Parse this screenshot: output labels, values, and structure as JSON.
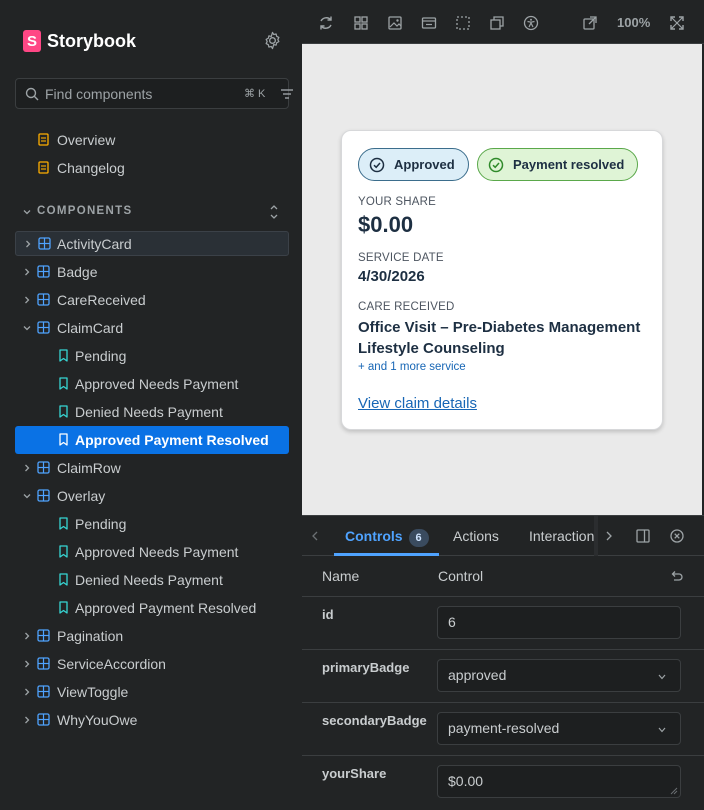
{
  "sidebar": {
    "brand": "Storybook",
    "search_placeholder": "Find components",
    "shortcut": "⌘ K",
    "docs": [
      {
        "label": "Overview"
      },
      {
        "label": "Changelog"
      }
    ],
    "section_title": "COMPONENTS",
    "components": [
      {
        "label": "ActivityCard"
      },
      {
        "label": "Badge"
      },
      {
        "label": "CareReceived"
      },
      {
        "label": "ClaimCard"
      },
      {
        "label": "Pending"
      },
      {
        "label": "Approved Needs Payment"
      },
      {
        "label": "Denied Needs Payment"
      },
      {
        "label": "Approved Payment Resolved"
      },
      {
        "label": "ClaimRow"
      },
      {
        "label": "Overlay"
      },
      {
        "label": "Pending"
      },
      {
        "label": "Approved Needs Payment"
      },
      {
        "label": "Denied Needs Payment"
      },
      {
        "label": "Approved Payment Resolved"
      },
      {
        "label": "Pagination"
      },
      {
        "label": "ServiceAccordion"
      },
      {
        "label": "ViewToggle"
      },
      {
        "label": "WhyYouOwe"
      }
    ]
  },
  "toolbar": {
    "zoom": "100%"
  },
  "card": {
    "badge_primary": "Approved",
    "badge_secondary": "Payment resolved",
    "share_label": "YOUR SHARE",
    "share_value": "$0.00",
    "date_label": "SERVICE DATE",
    "date_value": "4/30/2026",
    "care_label": "CARE RECEIVED",
    "care_line1": "Office Visit – Pre-Diabetes Management",
    "care_line2": "Lifestyle Counseling",
    "more": "+ and 1 more service",
    "link": "View claim details"
  },
  "panel": {
    "tabs": [
      {
        "label": "Controls",
        "count": "6"
      },
      {
        "label": "Actions"
      },
      {
        "label": "Interactions"
      }
    ],
    "col_name": "Name",
    "col_control": "Control",
    "rows": [
      {
        "name": "id",
        "value": "6"
      },
      {
        "name": "primaryBadge",
        "value": "approved"
      },
      {
        "name": "secondaryBadge",
        "value": "payment-resolved"
      },
      {
        "name": "yourShare",
        "value": "$0.00"
      }
    ]
  },
  "colors": {
    "accent": "#0a72e5",
    "brand": "#ff4785",
    "story_icon": "#37d5d3",
    "component_icon": "#4fa3ff",
    "doc_icon": "#ffae00"
  }
}
